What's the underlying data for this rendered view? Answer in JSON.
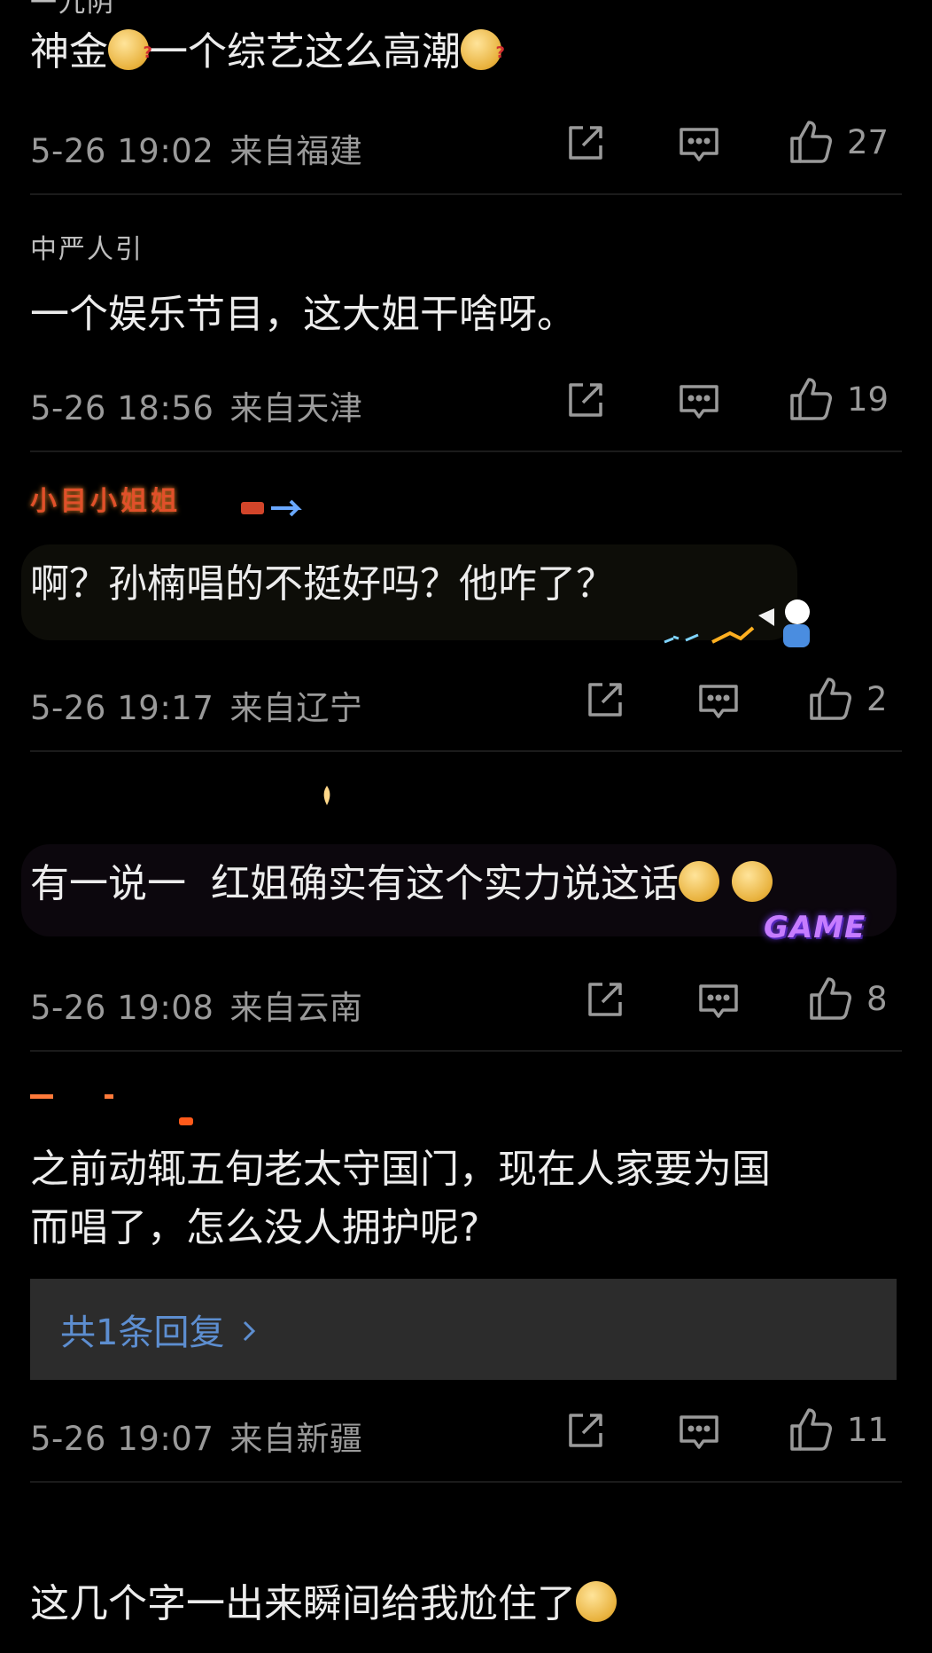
{
  "comments": [
    {
      "username": "一九阴",
      "text": "神金",
      "text_after_emoji": "一个综艺这么高潮",
      "date": "5-26 19:02",
      "location": "来自福建",
      "likes": "27"
    },
    {
      "username": "中严人引",
      "text": "一个娱乐节目，这大姐干啥呀。",
      "date": "5-26 18:56",
      "location": "来自天津",
      "likes": "19"
    },
    {
      "username": "小目小姐姐",
      "text": "啊？孙楠唱的不挺好吗？他咋了？",
      "date": "5-26 19:17",
      "location": "来自辽宁",
      "likes": "2"
    },
    {
      "username": "",
      "text": "有一说一  红姐确实有这个实力说这话",
      "sticker": "GAME",
      "date": "5-26 19:08",
      "location": "来自云南",
      "likes": "8"
    },
    {
      "username": "",
      "text": "之前动辄五旬老太守国门，现在人家要为国\n而唱了，怎么没人拥护呢?",
      "reply_label": "共1条回复",
      "date": "5-26 19:07",
      "location": "来自新疆",
      "likes": "11"
    },
    {
      "text": "这几个字一出来瞬间给我尬住了"
    }
  ],
  "colors": {
    "background": "#000000",
    "text": "#ececec",
    "meta": "#9a9a9a",
    "reply_link": "#5d8ed0",
    "reply_bg": "#2c2c2c"
  },
  "icons": [
    "share-icon",
    "comment-icon",
    "like-icon",
    "chevron-right-icon",
    "emoji-icon"
  ]
}
